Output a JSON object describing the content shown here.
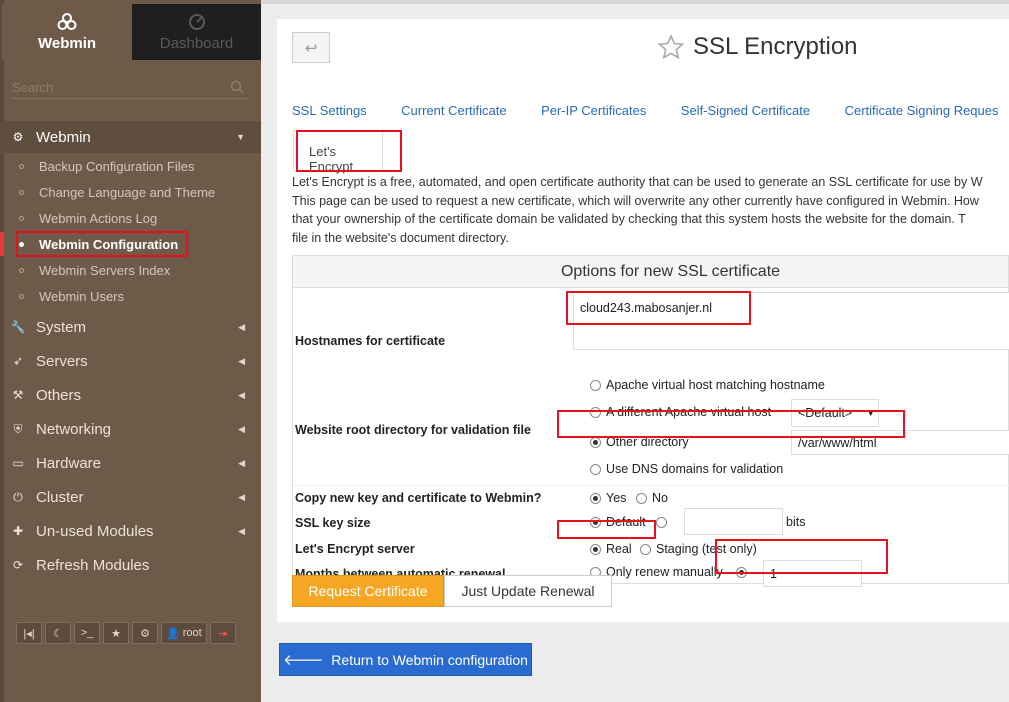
{
  "sidebar": {
    "switch_webmin": "Webmin",
    "switch_dashboard": "Dashboard",
    "search_placeholder": "Search",
    "section_webmin": "Webmin",
    "webmin_items": [
      {
        "label": "Backup Configuration Files"
      },
      {
        "label": "Change Language and Theme"
      },
      {
        "label": "Webmin Actions Log"
      },
      {
        "label": "Webmin Configuration"
      },
      {
        "label": "Webmin Servers Index"
      },
      {
        "label": "Webmin Users"
      }
    ],
    "sections": [
      {
        "label": "System"
      },
      {
        "label": "Servers"
      },
      {
        "label": "Others"
      },
      {
        "label": "Networking"
      },
      {
        "label": "Hardware"
      },
      {
        "label": "Cluster"
      },
      {
        "label": "Un-used Modules"
      },
      {
        "label": "Refresh Modules"
      }
    ],
    "user_label": "root"
  },
  "page": {
    "title": "SSL Encryption",
    "tabs": [
      "SSL Settings",
      "Current Certificate",
      "Per-IP Certificates",
      "Self-Signed Certificate",
      "Certificate Signing Reques"
    ],
    "active_tab": "Let's Encrypt",
    "description_lines": [
      "Let's Encrypt is a free, automated, and open certificate authority that can be used to generate an SSL certificate for use by W",
      "This page can be used to request a new certificate, which will overwrite any other currently have configured in Webmin. How",
      "that your ownership of the certificate domain be validated by checking that this system hosts the website for the domain. T",
      "file in the website's document directory."
    ]
  },
  "form": {
    "header": "Options for new SSL certificate",
    "hostnames_label": "Hostnames for certificate",
    "hostnames_value": "cloud243.mabosanjer.nl",
    "webroot_label": "Website root directory for validation file",
    "webroot_opt_apache_match": "Apache virtual host matching hostname",
    "webroot_opt_apache_other": "A different Apache virtual host",
    "webroot_vhost_select": "<Default>",
    "webroot_opt_other_dir": "Other directory",
    "webroot_other_dir_value": "/var/www/html",
    "webroot_opt_dns": "Use DNS domains for validation",
    "copy_label": "Copy new key and certificate to Webmin?",
    "copy_yes": "Yes",
    "copy_no": "No",
    "keysize_label": "SSL key size",
    "keysize_default": "Default",
    "keysize_unit": "bits",
    "server_label": "Let's Encrypt server",
    "server_real": "Real",
    "server_staging": "Staging (test only)",
    "renew_label": "Months between automatic renewal",
    "renew_manual": "Only renew manually",
    "renew_value": "1"
  },
  "buttons": {
    "request": "Request Certificate",
    "update_renewal": "Just Update Renewal",
    "return": "Return to Webmin configuration"
  },
  "colors": {
    "sidebar_bg": "#6e5a49",
    "accent_orange": "#f5a623",
    "link_blue": "#2a6ab6",
    "return_blue": "#2a6bd1",
    "highlight_red": "#e8101a"
  }
}
